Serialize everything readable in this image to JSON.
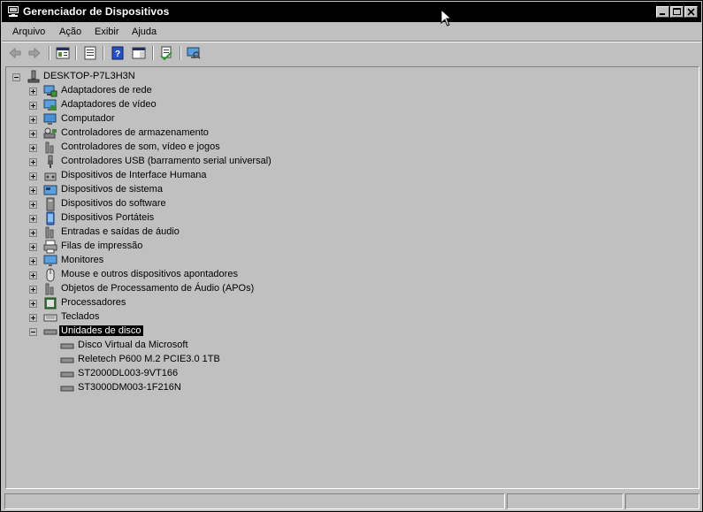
{
  "window": {
    "title": "Gerenciador de Dispositivos"
  },
  "menu": [
    "Arquivo",
    "Ação",
    "Exibir",
    "Ajuda"
  ],
  "toolbar": [
    "back-arrow-icon",
    "forward-arrow-icon",
    "console-tree-icon",
    "properties-icon",
    "help-icon",
    "action-pane-icon",
    "update-driver-icon",
    "monitor-scan-icon"
  ],
  "tree": {
    "root": "DESKTOP-P7L3H3N",
    "categories": [
      "Adaptadores de rede",
      "Adaptadores de vídeo",
      "Computador",
      "Controladores de armazenamento",
      "Controladores de som, vídeo e jogos",
      "Controladores USB (barramento serial universal)",
      "Dispositivos de Interface Humana",
      "Dispositivos de sistema",
      "Dispositivos do software",
      "Dispositivos Portáteis",
      "Entradas e saídas de áudio",
      "Filas de impressão",
      "Monitores",
      "Mouse e outros dispositivos apontadores",
      "Objetos de Processamento de Áudio (APOs)",
      "Processadores",
      "Teclados",
      "Unidades de disco"
    ],
    "selected": "Unidades de disco",
    "expanded": "Unidades de disco",
    "disk_drives": [
      "Disco Virtual da Microsoft",
      "Reletech P600 M.2 PCIE3.0 1TB",
      "ST2000DL003-9VT166",
      "ST3000DM003-1F216N"
    ]
  },
  "colors": {
    "titlebar": "#000000",
    "window": "#c0c0c0",
    "selection": "#000000"
  }
}
